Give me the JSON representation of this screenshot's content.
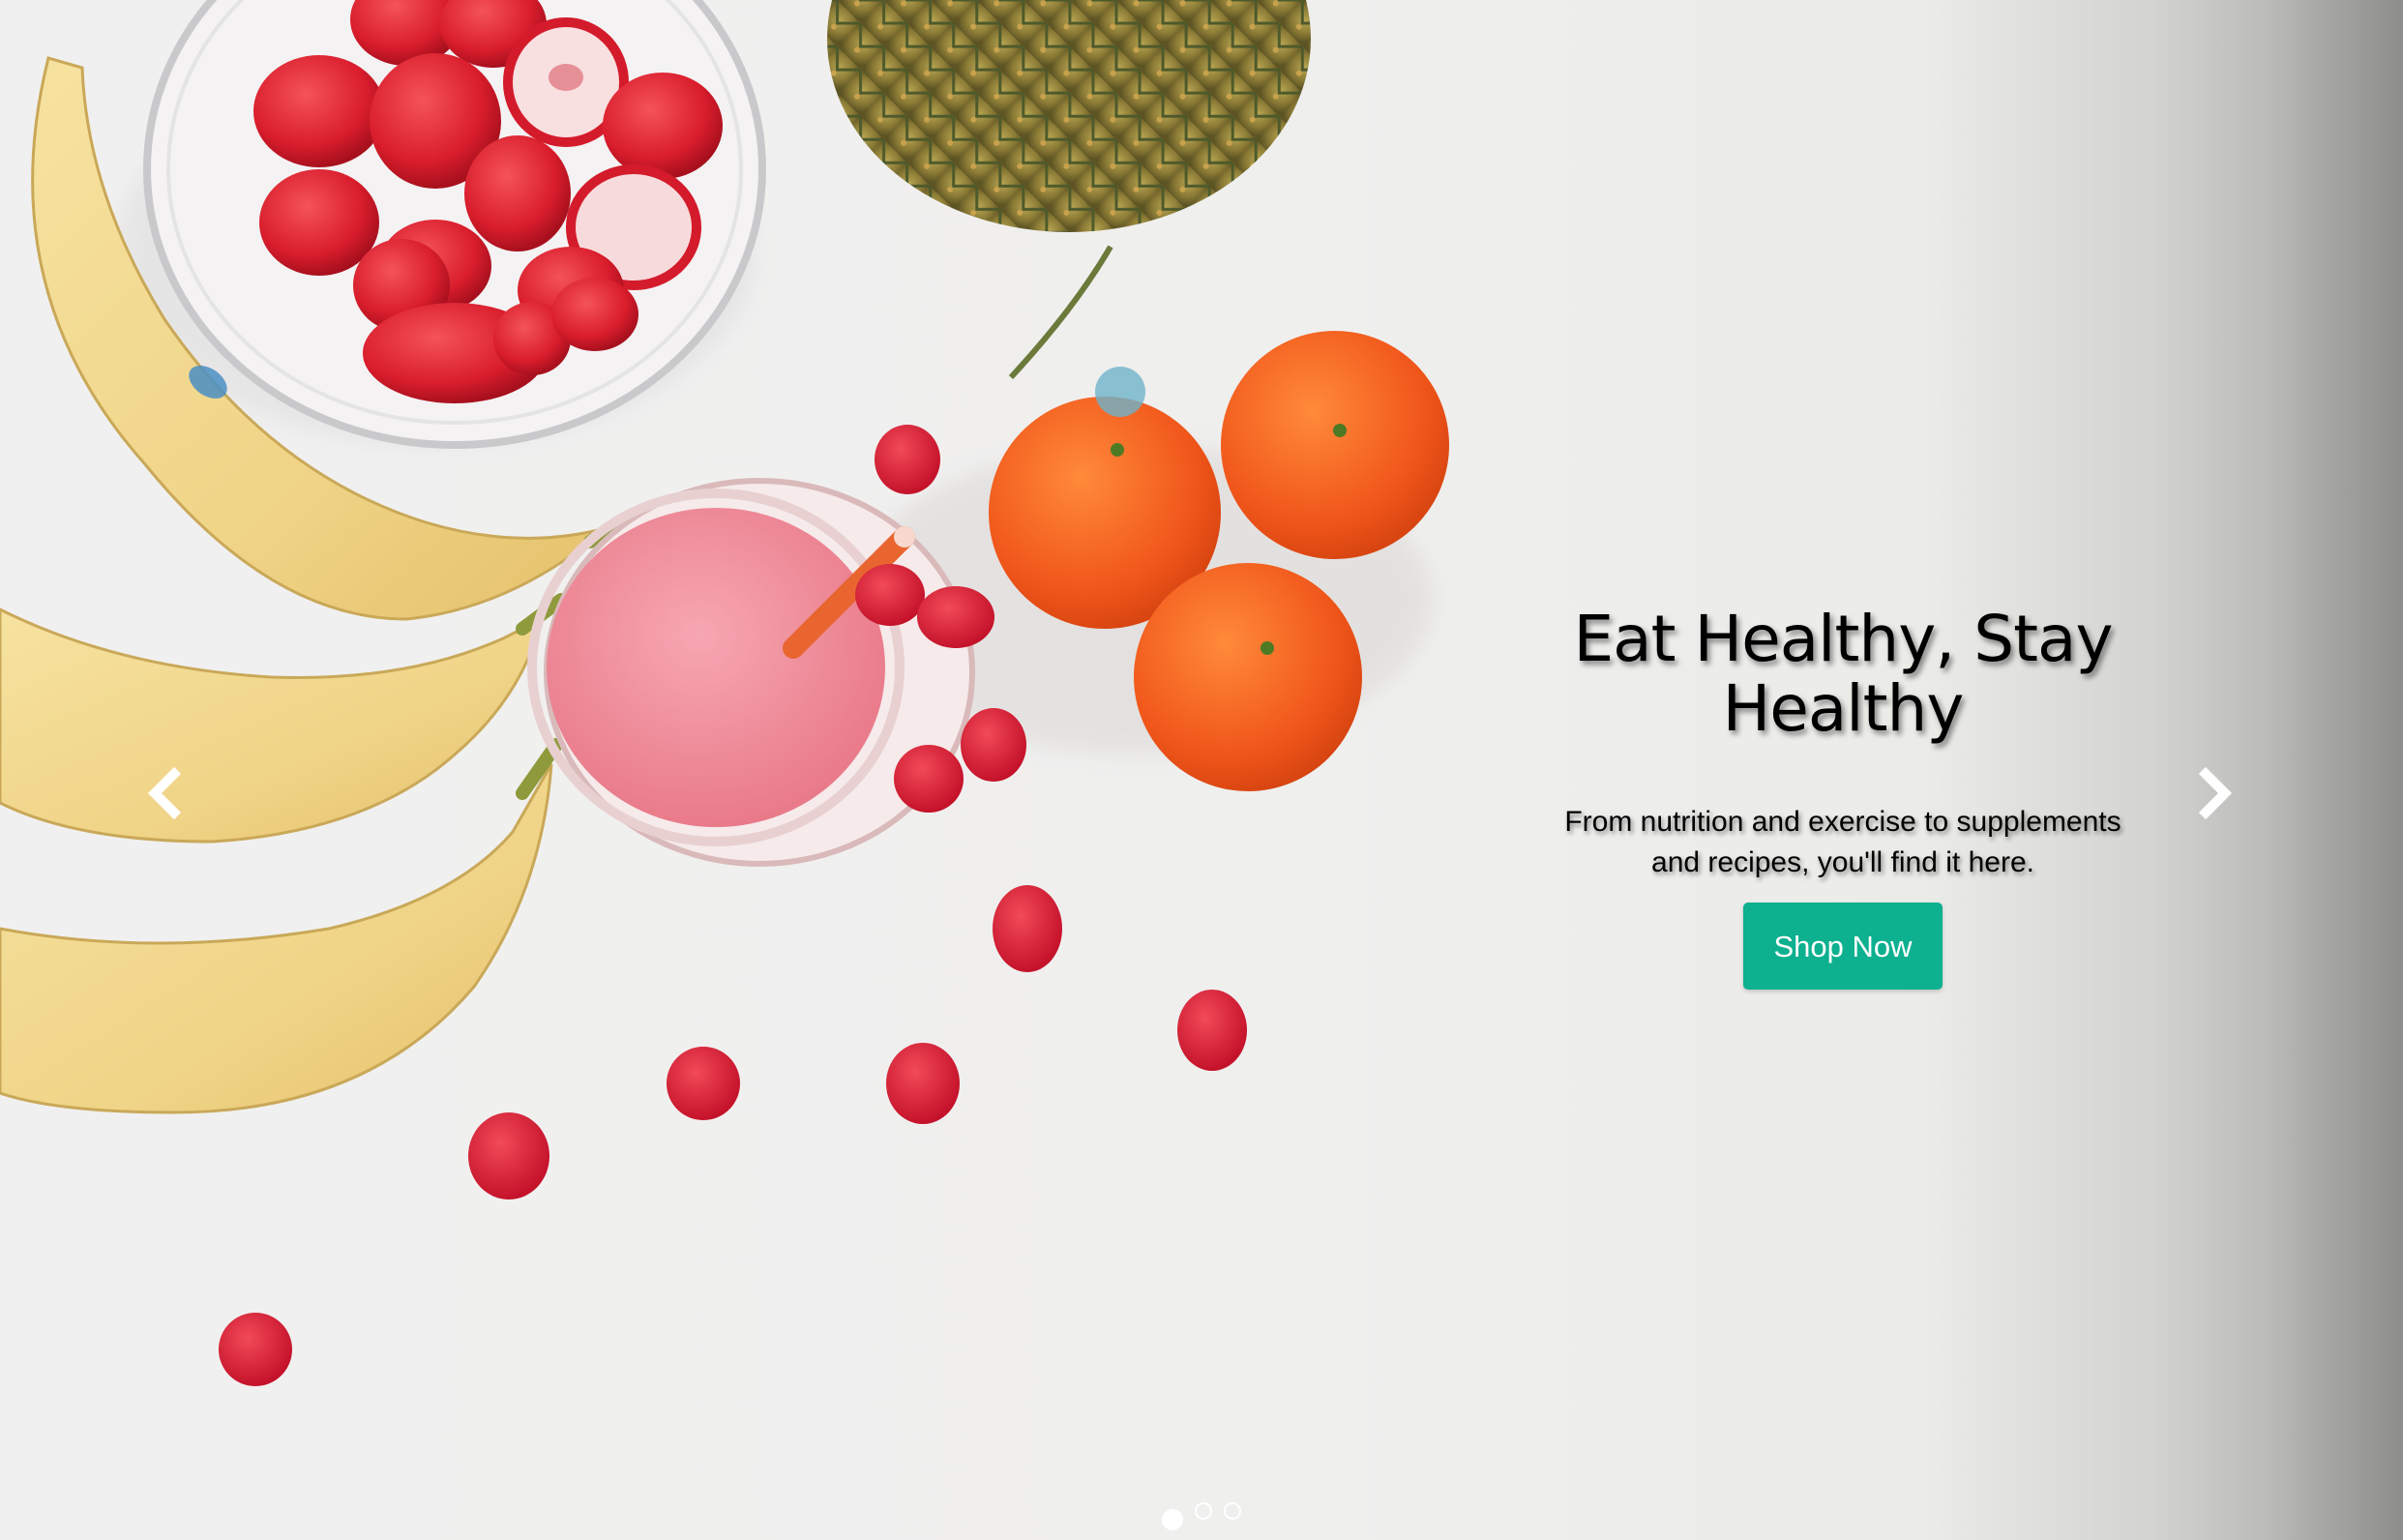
{
  "hero": {
    "title": "Eat Healthy, Stay Healthy",
    "subtitle": "From nutrition and exercise to supplements and recipes, you'll find it here.",
    "cta_label": "Shop Now"
  },
  "carousel": {
    "prev_icon": "chevron-left-icon",
    "next_icon": "chevron-right-icon",
    "slide_count": 3,
    "active_slide": 1
  },
  "colors": {
    "cta_background": "#0db08f",
    "cta_text": "#ffffff"
  }
}
